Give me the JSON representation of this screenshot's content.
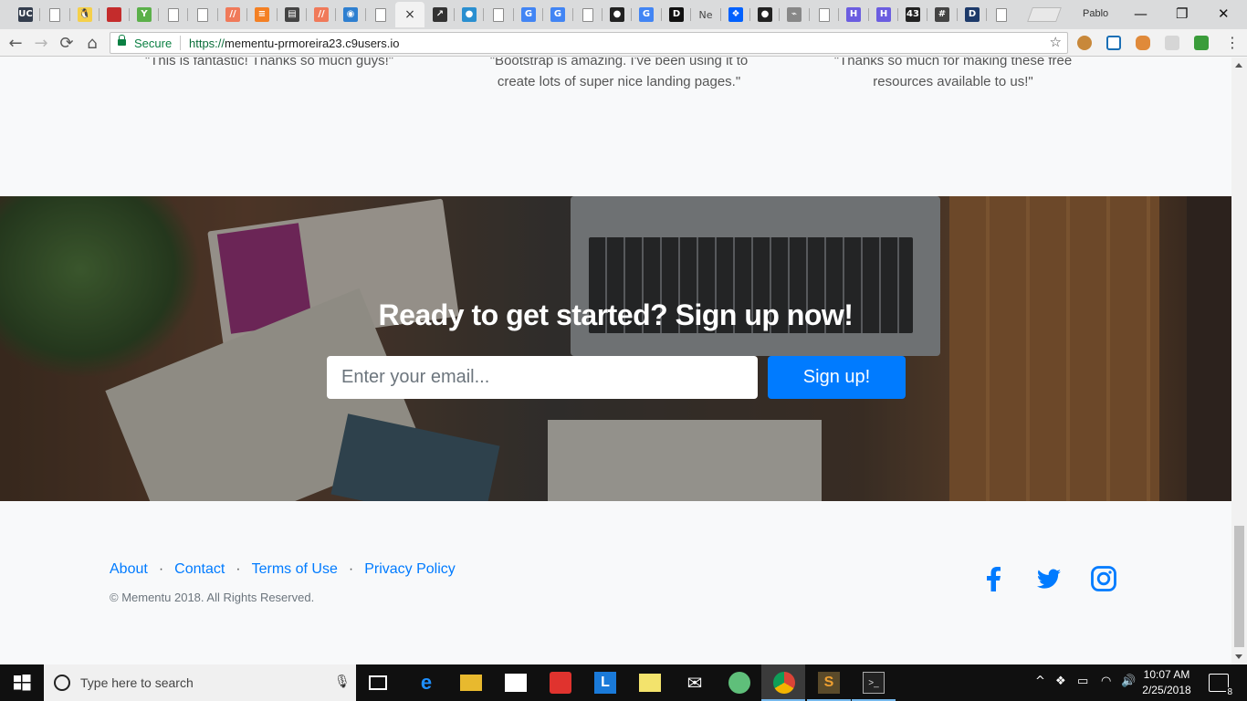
{
  "browser": {
    "profile_name": "Pablo",
    "secure_label": "Secure",
    "url_scheme": "https://",
    "url_host": "mementu-prmoreira23.c9users.io",
    "active_tab_close": "×",
    "tabs": [
      {
        "name": "tab-favicon-uc",
        "label": "UC",
        "color": "#333d4d"
      },
      {
        "name": "tab-favicon-page",
        "label": "",
        "color": "page"
      },
      {
        "name": "tab-favicon-penguin",
        "label": "🐧",
        "color": "#f5d04a"
      },
      {
        "name": "tab-favicon-red",
        "label": "",
        "color": "#c42c2c"
      },
      {
        "name": "tab-favicon-leaf",
        "label": "Y",
        "color": "#5bb04a"
      },
      {
        "name": "tab-favicon-page",
        "label": "",
        "color": "page"
      },
      {
        "name": "tab-favicon-page",
        "label": "",
        "color": "page"
      },
      {
        "name": "tab-favicon-stripes",
        "label": "//",
        "color": "#f07a5a"
      },
      {
        "name": "tab-favicon-stackoverflow",
        "label": "≡",
        "color": "#f48024"
      },
      {
        "name": "tab-favicon-pad",
        "label": "▤",
        "color": "#444444"
      },
      {
        "name": "tab-favicon-stripes",
        "label": "//",
        "color": "#f07a5a"
      },
      {
        "name": "tab-favicon-eye",
        "label": "◉",
        "color": "#2e7fd0"
      },
      {
        "name": "tab-favicon-page",
        "label": "",
        "color": "page"
      },
      {
        "name": "tab-active",
        "label": "",
        "color": "active"
      },
      {
        "name": "tab-favicon-chart",
        "label": "↗",
        "color": "#333333"
      },
      {
        "name": "tab-favicon-bird",
        "label": "●",
        "color": "#2a8fd0"
      },
      {
        "name": "tab-favicon-page",
        "label": "",
        "color": "page"
      },
      {
        "name": "tab-favicon-google",
        "label": "G",
        "color": "#4285f4"
      },
      {
        "name": "tab-favicon-google",
        "label": "G",
        "color": "#4285f4"
      },
      {
        "name": "tab-favicon-page",
        "label": "",
        "color": "page"
      },
      {
        "name": "tab-favicon-github",
        "label": "●",
        "color": "#222222"
      },
      {
        "name": "tab-favicon-google",
        "label": "G",
        "color": "#4285f4"
      },
      {
        "name": "tab-favicon-dev",
        "label": "D",
        "color": "#111111"
      },
      {
        "name": "tab-favicon-ne",
        "label": "Ne",
        "color": "text"
      },
      {
        "name": "tab-favicon-dropbox",
        "label": "❖",
        "color": "#0061fe"
      },
      {
        "name": "tab-favicon-github",
        "label": "●",
        "color": "#222222"
      },
      {
        "name": "tab-favicon-link",
        "label": "⌁",
        "color": "#888888"
      },
      {
        "name": "tab-favicon-page",
        "label": "",
        "color": "page"
      },
      {
        "name": "tab-favicon-h",
        "label": "H",
        "color": "#6b5de0"
      },
      {
        "name": "tab-favicon-h",
        "label": "H",
        "color": "#6b5de0"
      },
      {
        "name": "tab-favicon-43",
        "label": "43",
        "color": "#222222"
      },
      {
        "name": "tab-favicon-hash",
        "label": "#",
        "color": "#444444"
      },
      {
        "name": "tab-favicon-d",
        "label": "D",
        "color": "#1d3a6a"
      },
      {
        "name": "tab-favicon-page",
        "label": "",
        "color": "page"
      }
    ]
  },
  "page": {
    "testimonials": [
      {
        "text": "\"This is fantastic! Thanks so much guys!\""
      },
      {
        "text": "\"Bootstrap is amazing. I've been using it to create lots of super nice landing pages.\""
      },
      {
        "text": "\"Thanks so much for making these free resources available to us!\""
      }
    ],
    "cta": {
      "title": "Ready to get started? Sign up now!",
      "email_placeholder": "Enter your email...",
      "button_label": "Sign up!"
    },
    "footer": {
      "links": [
        "About",
        "Contact",
        "Terms of Use",
        "Privacy Policy"
      ],
      "separator": "·",
      "copyright": "© Mementu 2018. All Rights Reserved.",
      "social_icons": [
        "facebook-icon",
        "twitter-icon",
        "instagram-icon"
      ],
      "accent": "#007bff"
    }
  },
  "taskbar": {
    "search_placeholder": "Type here to search",
    "time": "10:07 AM",
    "date": "2/25/2018",
    "notification_count": "8"
  }
}
